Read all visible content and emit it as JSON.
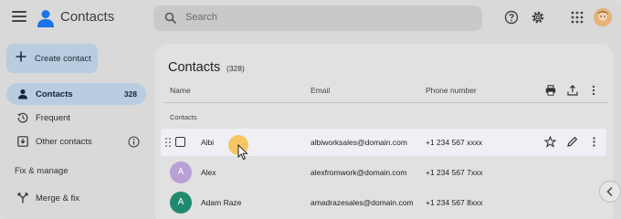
{
  "app": {
    "title": "Contacts"
  },
  "search": {
    "placeholder": "Search"
  },
  "sidebar": {
    "create_label": "Create contact",
    "items": [
      {
        "label": "Contacts",
        "count": "328",
        "icon": "person-icon"
      },
      {
        "label": "Frequent",
        "icon": "history-icon"
      },
      {
        "label": "Other contacts",
        "icon": "download-box-icon"
      }
    ],
    "section_title": "Fix & manage",
    "fix_items": [
      {
        "label": "Merge & fix",
        "icon": "merge-icon"
      }
    ]
  },
  "main": {
    "title": "Contacts",
    "count": "(328)",
    "columns": {
      "name": "Name",
      "email": "Email",
      "phone": "Phone number"
    },
    "group_label": "Contacts",
    "rows": [
      {
        "name": "Albi",
        "email": "albiworksales@domain.com",
        "phone": "+1 234 567 xxxx",
        "avatar": ""
      },
      {
        "name": "Alex",
        "email": "alexfromwork@domain.com",
        "phone": "+1 234 567 7xxx",
        "avatar": "A",
        "color": "#b9a0d6"
      },
      {
        "name": "Adam Raze",
        "email": "amadrazesales@domain.com",
        "phone": "+1 234 567 8xxx",
        "avatar": "A",
        "color": "#1f8a6e"
      }
    ]
  },
  "colors": {
    "accent": "#b9cde0",
    "cursor": "#f6be48",
    "brand": "#1a73e8"
  }
}
